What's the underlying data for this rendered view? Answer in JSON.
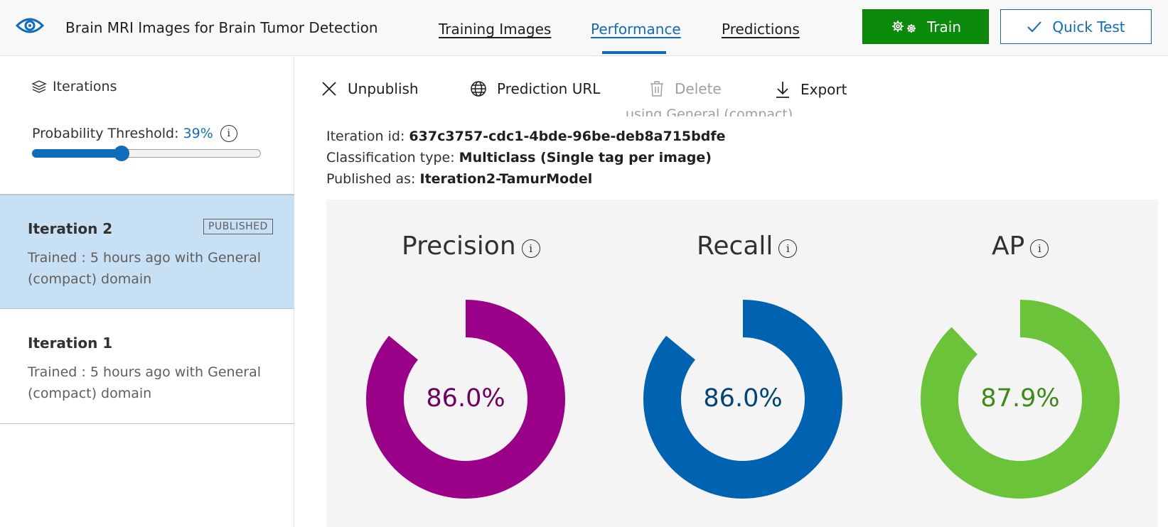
{
  "header": {
    "title": "Brain MRI Images for Brain Tumor Detection",
    "tabs": [
      {
        "label": "Training Images"
      },
      {
        "label": "Performance"
      },
      {
        "label": "Predictions"
      }
    ],
    "train_label": "Train",
    "quick_test_label": "Quick Test"
  },
  "sidebar": {
    "iterations_heading": "Iterations",
    "threshold_label": "Probability Threshold:",
    "threshold_value": "39%",
    "threshold_fraction": 0.39,
    "iterations": [
      {
        "name": "Iteration 2",
        "badge": "PUBLISHED",
        "description": "Trained : 5 hours ago with General (compact) domain"
      },
      {
        "name": "Iteration 1",
        "description": "Trained : 5 hours ago with General (compact) domain"
      }
    ]
  },
  "toolbar": {
    "unpublish": "Unpublish",
    "prediction_url": "Prediction URL",
    "delete": "Delete",
    "export": "Export"
  },
  "details": {
    "cut_off_text": "using General (compact)",
    "iteration_id_label": "Iteration id:",
    "iteration_id": "637c3757-cdc1-4bde-96be-deb8a715bdfe",
    "classification_label": "Classification type:",
    "classification_value": "Multiclass (Single tag per image)",
    "published_label": "Published as:",
    "published_value": "Iteration2-TamurModel"
  },
  "metrics": [
    {
      "title": "Precision",
      "value_text": "86.0%",
      "value": 86.0,
      "color": "#9b0089",
      "text_color": "#6e0062"
    },
    {
      "title": "Recall",
      "value_text": "86.0%",
      "value": 86.0,
      "color": "#0063b1",
      "text_color": "#004578"
    },
    {
      "title": "AP",
      "value_text": "87.9%",
      "value": 87.9,
      "color": "#6bc33a",
      "text_color": "#3d8a16"
    }
  ],
  "colors": {
    "accent": "#0f6cbd",
    "train_button": "#0b8a0b",
    "selected_iteration": "#c7e0f4"
  }
}
